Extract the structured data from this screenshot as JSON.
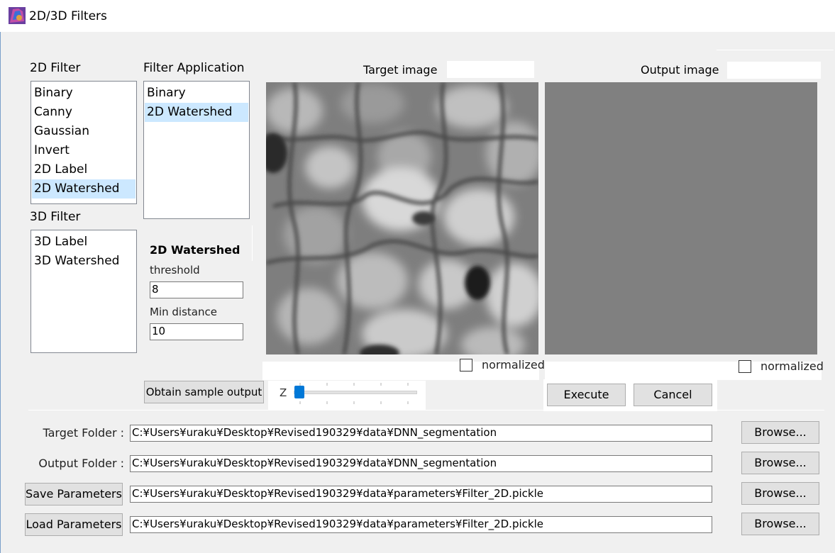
{
  "window": {
    "title": "2D/3D Filters"
  },
  "filters_2d": {
    "label": "2D Filter",
    "items": [
      "Binary",
      "Canny",
      "Gaussian",
      "Invert",
      "2D Label",
      "2D Watershed"
    ],
    "selected": "2D Watershed"
  },
  "filters_3d": {
    "label": "3D Filter",
    "items": [
      "3D Label",
      "3D Watershed"
    ]
  },
  "filter_application": {
    "label": "Filter Application",
    "items": [
      "Binary",
      "2D Watershed"
    ],
    "selected": "2D Watershed"
  },
  "params": {
    "title": "2D Watershed",
    "threshold_label": "threshold",
    "threshold_value": "8",
    "min_distance_label": "Min distance",
    "min_distance_value": "10"
  },
  "target_image": {
    "label": "Target image",
    "normalized_label": "normalized"
  },
  "output_image": {
    "label": "Output image",
    "normalized_label": "normalized"
  },
  "buttons": {
    "obtain_sample": "Obtain sample output",
    "execute": "Execute",
    "cancel": "Cancel",
    "browse": "Browse...",
    "save_params": "Save Parameters",
    "load_params": "Load Parameters"
  },
  "slider": {
    "label": "Z",
    "value_fraction": 0.0
  },
  "folders": {
    "target_label": "Target Folder :",
    "target_path": "C:¥Users¥uraku¥Desktop¥Revised190329¥data¥DNN_segmentation",
    "output_label": "Output Folder :",
    "output_path": "C:¥Users¥uraku¥Desktop¥Revised190329¥data¥DNN_segmentation",
    "save_path": "C:¥Users¥uraku¥Desktop¥Revised190329¥data¥parameters¥Filter_2D.pickle",
    "load_path": "C:¥Users¥uraku¥Desktop¥Revised190329¥data¥parameters¥Filter_2D.pickle"
  },
  "colors": {
    "window_bg": "#f0f0f0",
    "selection": "#cce8ff",
    "output_gray": "#808080",
    "slider_thumb": "#0078d7"
  }
}
